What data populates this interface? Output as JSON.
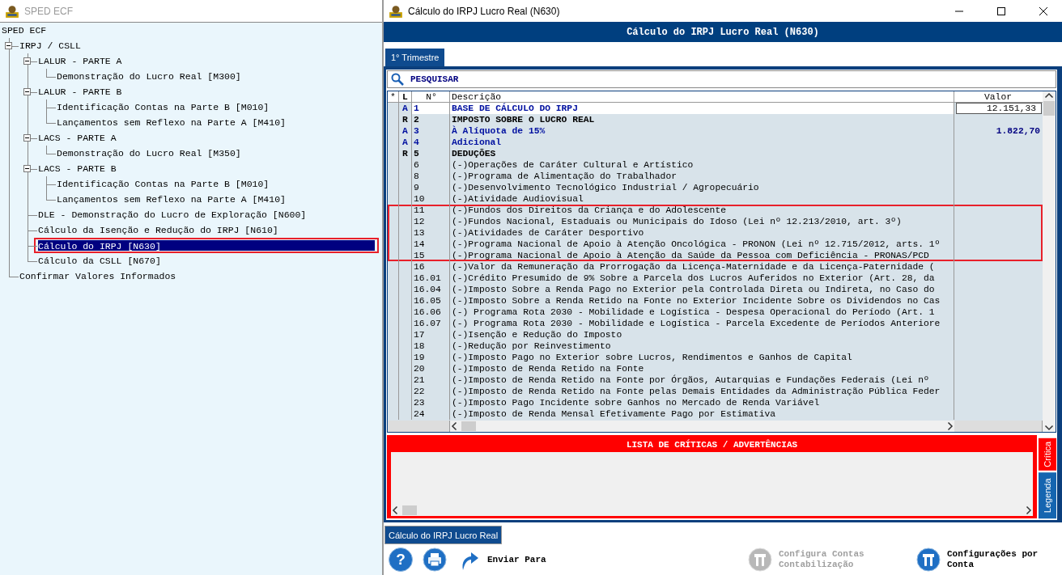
{
  "main_window": {
    "title": "SPED ECF"
  },
  "tree": {
    "root": "SPED ECF",
    "items": [
      {
        "label": "IRPJ / CSLL",
        "expanded": true,
        "selected": false,
        "highlighted": false,
        "children": [
          {
            "label": "LALUR - PARTE A",
            "expanded": true,
            "selected": false,
            "highlighted": false,
            "children": [
              {
                "label": "Demonstração do Lucro Real [M300]",
                "selected": false,
                "highlighted": false
              }
            ]
          },
          {
            "label": "LALUR - PARTE B",
            "expanded": true,
            "selected": false,
            "highlighted": false,
            "children": [
              {
                "label": "Identificação Contas na Parte B [M010]",
                "selected": false,
                "highlighted": false
              },
              {
                "label": "Lançamentos sem Reflexo na Parte A [M410]",
                "selected": false,
                "highlighted": false
              }
            ]
          },
          {
            "label": "LACS - PARTE A",
            "expanded": true,
            "selected": false,
            "highlighted": false,
            "children": [
              {
                "label": "Demonstração do Lucro Real [M350]",
                "selected": false,
                "highlighted": false
              }
            ]
          },
          {
            "label": "LACS - PARTE B",
            "expanded": true,
            "selected": false,
            "highlighted": false,
            "children": [
              {
                "label": "Identificação Contas na Parte B [M010]",
                "selected": false,
                "highlighted": false
              },
              {
                "label": "Lançamentos sem Reflexo na Parte A [M410]",
                "selected": false,
                "highlighted": false
              }
            ]
          },
          {
            "label": "DLE - Demonstração do Lucro de Exploração [N600]",
            "selected": false,
            "highlighted": false
          },
          {
            "label": "Cálculo da Isenção e Redução do IRPJ [N610]",
            "selected": false,
            "highlighted": false
          },
          {
            "label": "Cálculo do IRPJ [N630]",
            "selected": true,
            "highlighted": true
          },
          {
            "label": "Cálculo da CSLL [N670]",
            "selected": false,
            "highlighted": false
          }
        ]
      },
      {
        "label": "Confirmar Valores Informados",
        "selected": false,
        "highlighted": false
      }
    ]
  },
  "window": {
    "title": "Cálculo do IRPJ Lucro Real (N630)"
  },
  "header": "Cálculo do IRPJ Lucro Real (N630)",
  "tabs": [
    {
      "label": "1° Trimestre",
      "selected": true
    }
  ],
  "search": {
    "placeholder": "PESQUISAR"
  },
  "table": {
    "columns": [
      "*",
      "L",
      "N°",
      "Descrição",
      "Valor"
    ],
    "rows": [
      {
        "l": "A",
        "n": "1",
        "desc": "BASE DE CÁLCULO DO IRPJ",
        "kind": "input",
        "highlighted": false,
        "value": {
          "text": "12.151,33",
          "kind": "field"
        }
      },
      {
        "l": "R",
        "n": "2",
        "desc": "IMPOSTO SOBRE O LUCRO REAL",
        "kind": "section",
        "highlighted": false
      },
      {
        "l": "A",
        "n": "3",
        "desc": "À Alíquota de 15%",
        "kind": "input",
        "highlighted": false,
        "value": {
          "text": "1.822,70",
          "kind": "computed"
        }
      },
      {
        "l": "A",
        "n": "4",
        "desc": "Adicional",
        "kind": "input",
        "highlighted": false
      },
      {
        "l": "R",
        "n": "5",
        "desc": "DEDUÇÕES",
        "kind": "section",
        "highlighted": false
      },
      {
        "n": "6",
        "desc": "(-)Operações de Caráter Cultural e Artístico",
        "kind": "item",
        "highlighted": false
      },
      {
        "n": "8",
        "desc": "(-)Programa de Alimentação do Trabalhador",
        "kind": "item",
        "highlighted": false
      },
      {
        "n": "9",
        "desc": "(-)Desenvolvimento Tecnológico Industrial / Agropecuário",
        "kind": "item",
        "highlighted": false
      },
      {
        "n": "10",
        "desc": "(-)Atividade Audiovisual",
        "kind": "item",
        "highlighted": false
      },
      {
        "n": "11",
        "desc": "(-)Fundos dos Direitos da Criança e do Adolescente",
        "kind": "item",
        "highlighted": true
      },
      {
        "n": "12",
        "desc": "(-)Fundos Nacional, Estaduais ou Municipais do Idoso (Lei nº 12.213/2010, art. 3º)",
        "kind": "item",
        "highlighted": true
      },
      {
        "n": "13",
        "desc": "(-)Atividades de Caráter Desportivo",
        "kind": "item",
        "highlighted": true
      },
      {
        "n": "14",
        "desc": "(-)Programa Nacional de Apoio à Atenção Oncológica - PRONON (Lei nº 12.715/2012, arts. 1º",
        "kind": "item",
        "highlighted": true
      },
      {
        "n": "15",
        "desc": "(-)Programa Nacional de Apoio à Atenção da Saúde da Pessoa com Deficiência - PRONAS/PCD",
        "kind": "item",
        "highlighted": true
      },
      {
        "n": "16",
        "desc": "(-)Valor da Remuneração da Prorrogação da Licença-Maternidade e da Licença-Paternidade (",
        "kind": "item",
        "highlighted": false
      },
      {
        "n": "16.01",
        "desc": "(-)Crédito Presumido de 9% Sobre a Parcela dos Lucros Auferidos no Exterior (Art. 28, da",
        "kind": "item",
        "highlighted": false
      },
      {
        "n": "16.04",
        "desc": "(-)Imposto Sobre a Renda Pago no Exterior pela Controlada Direta ou Indireta, no Caso do",
        "kind": "item",
        "highlighted": false
      },
      {
        "n": "16.05",
        "desc": "(-)Imposto Sobre a Renda Retido na Fonte no Exterior Incidente Sobre os Dividendos no Cas",
        "kind": "item",
        "highlighted": false
      },
      {
        "n": "16.06",
        "desc": "(-) Programa Rota 2030 - Mobilidade e Logística - Despesa Operacional do Período (Art. 1",
        "kind": "item",
        "highlighted": false
      },
      {
        "n": "16.07",
        "desc": "(-) Programa Rota 2030 - Mobilidade e Logística - Parcela Excedente de Períodos Anteriore",
        "kind": "item",
        "highlighted": false
      },
      {
        "n": "17",
        "desc": "(-)Isenção e Redução do Imposto",
        "kind": "item",
        "highlighted": false
      },
      {
        "n": "18",
        "desc": "(-)Redução por Reinvestimento",
        "kind": "item",
        "highlighted": false
      },
      {
        "n": "19",
        "desc": "(-)Imposto Pago no Exterior sobre Lucros, Rendimentos e Ganhos de Capital",
        "kind": "item",
        "highlighted": false
      },
      {
        "n": "20",
        "desc": "(-)Imposto de Renda Retido na Fonte",
        "kind": "item",
        "highlighted": false
      },
      {
        "n": "21",
        "desc": "(-)Imposto de Renda Retido na Fonte por Órgãos, Autarquias e Fundações Federais (Lei nº",
        "kind": "item",
        "highlighted": false
      },
      {
        "n": "22",
        "desc": "(-)Imposto de Renda Retido na Fonte pelas Demais Entidades da Administração Pública Feder",
        "kind": "item",
        "highlighted": false
      },
      {
        "n": "23",
        "desc": "(-)Imposto Pago Incidente sobre Ganhos no Mercado de Renda Variável",
        "kind": "item",
        "highlighted": false
      },
      {
        "n": "24",
        "desc": "(-)Imposto de Renda Mensal Efetivamente Pago por Estimativa",
        "kind": "item",
        "highlighted": false
      }
    ]
  },
  "critics": {
    "title": "LISTA DE CRÍTICAS / ADVERTÊNCIAS",
    "side_tabs": [
      {
        "label": "Crítica",
        "selected": true
      },
      {
        "label": "Legenda",
        "selected": false
      }
    ]
  },
  "bottom_tabs": [
    {
      "label": "Cálculo do IRPJ Lucro Real",
      "selected": true
    }
  ],
  "toolbar": [
    {
      "kind": "help",
      "glyph": "?",
      "disabled": false
    },
    {
      "kind": "print",
      "disabled": false
    },
    {
      "kind": "send",
      "label": "Enviar Para",
      "disabled": false
    },
    {
      "kind": "accounts",
      "label": "Configura Contas Contabilização",
      "disabled": true
    },
    {
      "kind": "config",
      "label": "Configurações por Conta",
      "disabled": false
    }
  ]
}
